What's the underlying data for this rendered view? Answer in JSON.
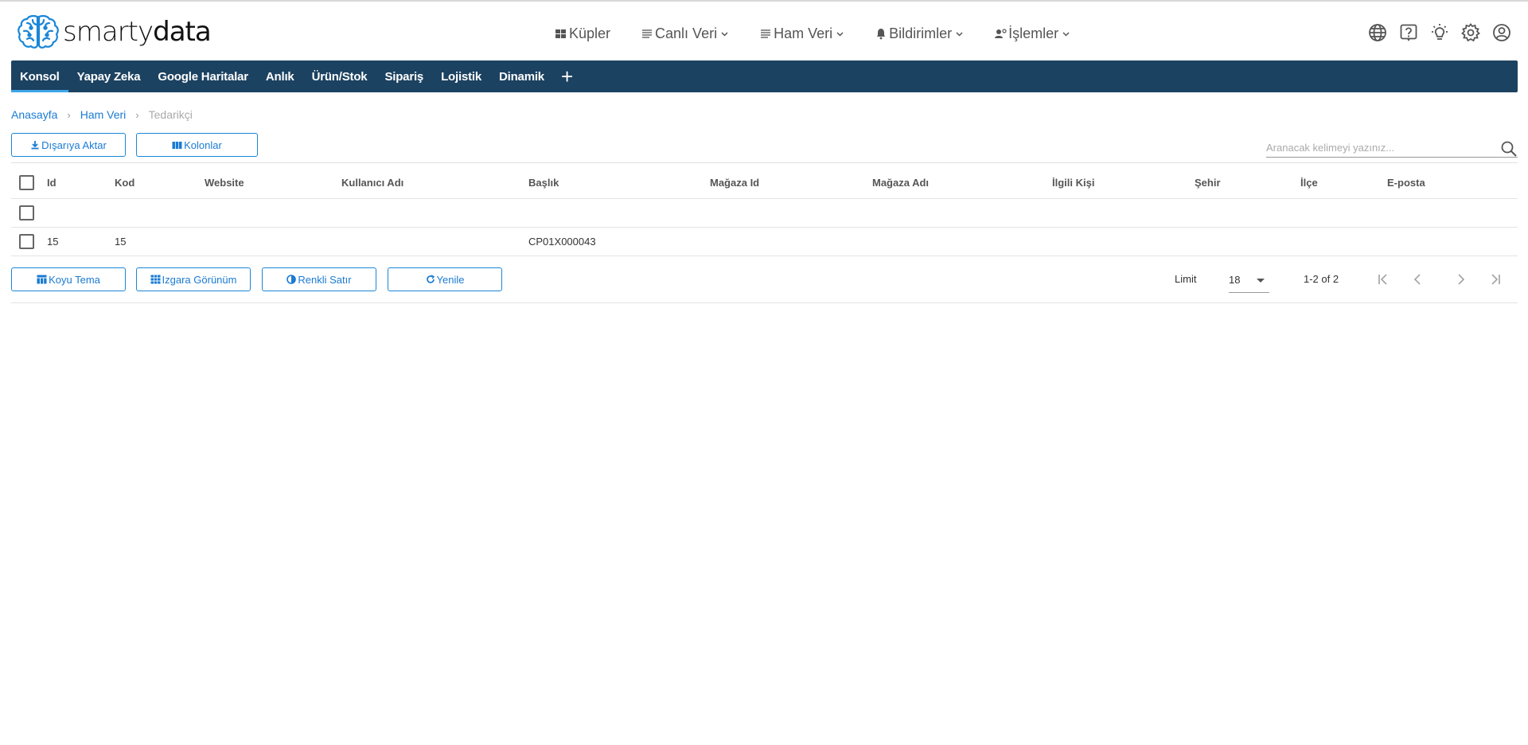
{
  "brand": {
    "smarty": "smarty",
    "data": "data"
  },
  "topnav": [
    {
      "label": "Küpler",
      "icon": "cubes-icon",
      "has_dropdown": false
    },
    {
      "label": "Canlı Veri",
      "icon": "list-icon",
      "has_dropdown": true
    },
    {
      "label": "Ham Veri",
      "icon": "list-icon",
      "has_dropdown": true
    },
    {
      "label": "Bildirimler",
      "icon": "bell-icon",
      "has_dropdown": true
    },
    {
      "label": "İşlemler",
      "icon": "user-gear-icon",
      "has_dropdown": true
    }
  ],
  "top_icons": [
    "globe-icon",
    "help-icon",
    "theme-bulb-icon",
    "settings-icon",
    "account-icon"
  ],
  "tabs": [
    {
      "label": "Konsol",
      "active": true
    },
    {
      "label": "Yapay Zeka",
      "active": false
    },
    {
      "label": "Google Haritalar",
      "active": false
    },
    {
      "label": "Anlık",
      "active": false
    },
    {
      "label": "Ürün/Stok",
      "active": false
    },
    {
      "label": "Sipariş",
      "active": false
    },
    {
      "label": "Lojistik",
      "active": false
    },
    {
      "label": "Dinamik",
      "active": false
    }
  ],
  "tab_add": "+",
  "breadcrumb": {
    "home": "Anasayfa",
    "section": "Ham Veri",
    "current": "Tedarikçi"
  },
  "toolbar": {
    "export_label": "Dışarıya Aktar",
    "columns_label": "Kolonlar"
  },
  "search": {
    "placeholder": "Aranacak kelimeyi yazınız..."
  },
  "table": {
    "columns": [
      "Id",
      "Kod",
      "Website",
      "Kullanıcı Adı",
      "Başlık",
      "Mağaza Id",
      "Mağaza Adı",
      "İlgili Kişi",
      "Şehir",
      "İlçe",
      "E-posta"
    ],
    "rows": [
      [
        "",
        "",
        "",
        "",
        "",
        "",
        "",
        "",
        "",
        "",
        ""
      ],
      [
        "15",
        "15",
        "",
        "",
        "CP01X000043",
        "",
        "",
        "",
        "",
        "",
        ""
      ]
    ]
  },
  "footer": {
    "dark_theme_label": "Koyu Tema",
    "grid_view_label": "Izgara Görünüm",
    "colored_row_label": "Renkli Satır",
    "refresh_label": "Yenile",
    "limit_label": "Limit",
    "limit_value": "18",
    "range_text": "1-2 of 2"
  },
  "colors": {
    "accent": "#1a7bd3",
    "tabbar": "#1c4261",
    "tab_indicator": "#3fa6e8",
    "logo": "#1a86d8"
  }
}
